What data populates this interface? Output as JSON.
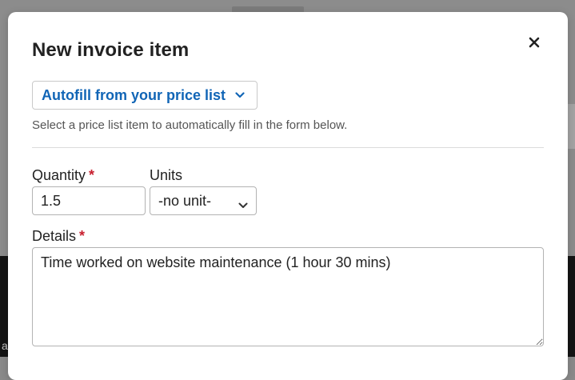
{
  "background": {
    "right_edge_glyph": "a"
  },
  "modal": {
    "title": "New invoice item",
    "close_icon": "close-icon",
    "autofill": {
      "label": "Autofill from your price list",
      "icon": "chevron-down-icon",
      "accent": "#1165b6"
    },
    "hint": "Select a price list item to automatically fill in the form below.",
    "quantity": {
      "label": "Quantity",
      "required_mark": "*",
      "value": "1.5"
    },
    "units": {
      "label": "Units",
      "value": "-no unit-"
    },
    "details": {
      "label": "Details",
      "required_mark": "*",
      "value": "Time worked on website maintenance (1 hour 30 mins)"
    },
    "required_color": "#c8202f"
  }
}
